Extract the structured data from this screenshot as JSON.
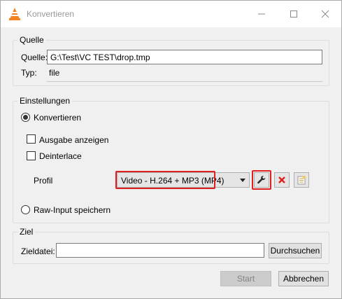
{
  "window": {
    "title": "Konvertieren"
  },
  "source": {
    "legend": "Quelle",
    "source_label": "Quelle:",
    "source_value": "G:\\Test\\VC TEST\\drop.tmp",
    "type_label": "Typ:",
    "type_value": "file"
  },
  "settings": {
    "legend": "Einstellungen",
    "convert_label": "Konvertieren",
    "convert_selected": true,
    "show_output_label": "Ausgabe anzeigen",
    "show_output_checked": false,
    "deinterlace_label": "Deinterlace",
    "deinterlace_checked": false,
    "profile_label": "Profil",
    "profile_value": "Video - H.264 + MP3 (MP4)",
    "raw_input_label": "Raw-Input speichern",
    "raw_input_selected": false
  },
  "destination": {
    "legend": "Ziel",
    "file_label": "Zieldatei:",
    "file_value": "",
    "browse_label": "Durchsuchen"
  },
  "footer": {
    "start_label": "Start",
    "start_enabled": false,
    "cancel_label": "Abbrechen"
  },
  "colors": {
    "highlight": "#e02020",
    "vlc_orange": "#f58220"
  },
  "icons": {
    "app": "vlc-cone-icon",
    "edit_profile": "wrench-icon",
    "delete_profile": "red-x-icon",
    "new_profile": "new-profile-icon"
  }
}
